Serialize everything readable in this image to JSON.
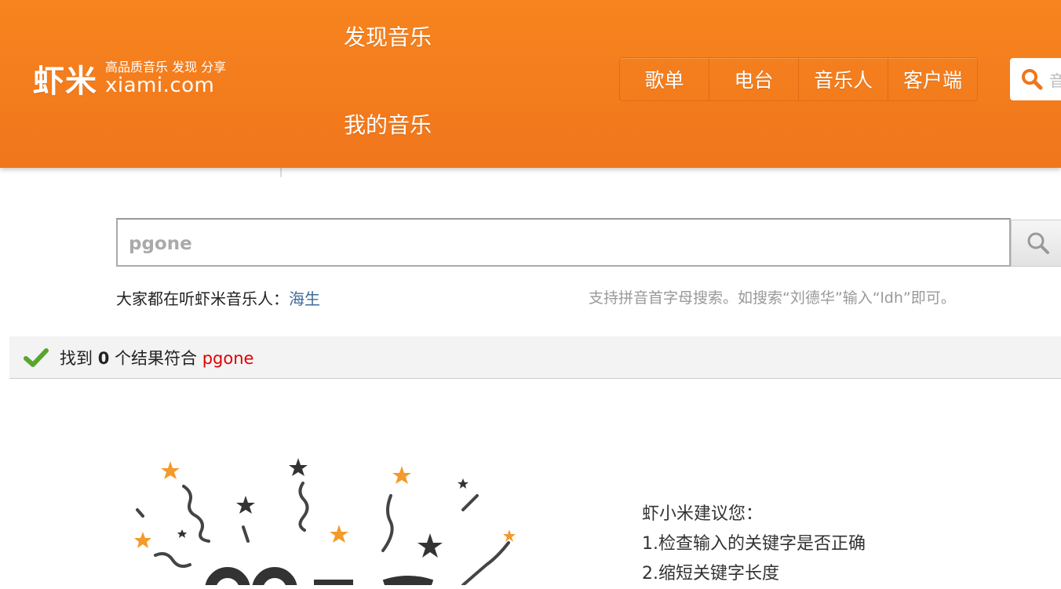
{
  "header": {
    "logo_mark": "虾米",
    "logo_tagline": "高品质音乐 发现 分享",
    "logo_domain": "xiami.com",
    "nav_discover": "发现音乐",
    "nav_mine": "我的音乐",
    "subnav": [
      "歌单",
      "电台",
      "音乐人",
      "客户端"
    ],
    "search_placeholder": "音"
  },
  "search": {
    "value": "pgone",
    "button_icon": "search-icon"
  },
  "hints": {
    "popular_prefix": "大家都在听虾米音乐人：",
    "popular_artist": "海生",
    "pinyin_tip": "支持拼音首字母搜索。如搜索“刘德华”输入“ldh”即可。"
  },
  "result": {
    "icon": "check-icon",
    "prefix": "找到",
    "count": "0",
    "middle": "个结果符合",
    "keyword": "pgone"
  },
  "suggestions": {
    "title": "虾小米建议您：",
    "items": [
      "1.检查输入的关键字是否正确",
      "2.缩短关键字长度"
    ]
  },
  "colors": {
    "brand_orange": "#f7841f",
    "link_blue": "#3e6b9c",
    "keyword_red": "#dd0000",
    "check_green": "#5aa531"
  }
}
